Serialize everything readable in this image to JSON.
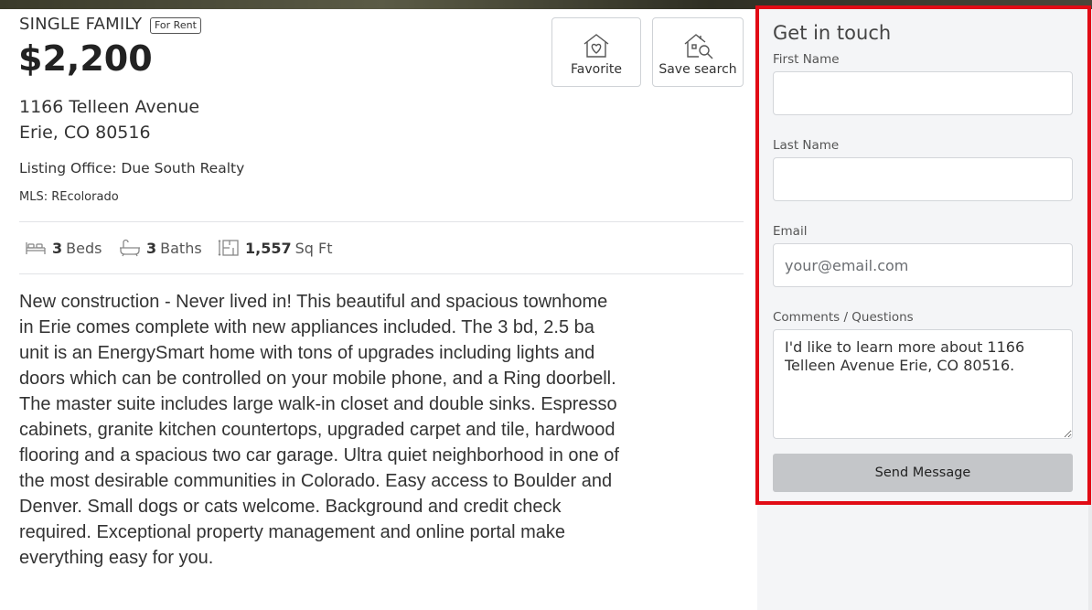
{
  "listing": {
    "property_type": "SINGLE FAMILY",
    "status_badge": "For Rent",
    "price": "$2,200",
    "address_line1": "1166 Telleen Avenue",
    "address_line2": "Erie, CO 80516",
    "listing_office": "Listing Office: Due South Realty",
    "mls": "MLS: REcolorado",
    "actions": {
      "favorite_label": "Favorite",
      "save_search_label": "Save search"
    },
    "stats": {
      "beds_value": "3",
      "beds_label": "Beds",
      "baths_value": "3",
      "baths_label": "Baths",
      "sqft_value": "1,557",
      "sqft_label": "Sq Ft"
    },
    "description": "New construction - Never lived in! This beautiful and spacious townhome in Erie comes complete with new appliances included. The 3 bd, 2.5 ba unit is an EnergySmart home with tons of upgrades including lights and doors which can be controlled on your mobile phone, and a Ring doorbell. The master suite includes large walk-in closet and double sinks. Espresso cabinets, granite kitchen countertops, upgraded carpet and tile, hardwood flooring and a spacious two car garage. Ultra quiet neighborhood in one of the most desirable communities in Colorado. Easy access to Boulder and Denver. Small dogs or cats welcome. Background and credit check required. Exceptional property management and online portal make everything easy for you."
  },
  "contact_form": {
    "title": "Get in touch",
    "first_name_label": "First Name",
    "first_name_value": "",
    "last_name_label": "Last Name",
    "last_name_value": "",
    "email_label": "Email",
    "email_placeholder": "your@email.com",
    "email_value": "",
    "comments_label": "Comments / Questions",
    "comments_value": "I'd like to learn more about 1166 Telleen Avenue Erie, CO 80516.",
    "send_label": "Send Message"
  },
  "colors": {
    "highlight_border": "#e10b15",
    "send_button_bg": "#c4c6c9",
    "panel_bg": "#f4f5f7"
  }
}
